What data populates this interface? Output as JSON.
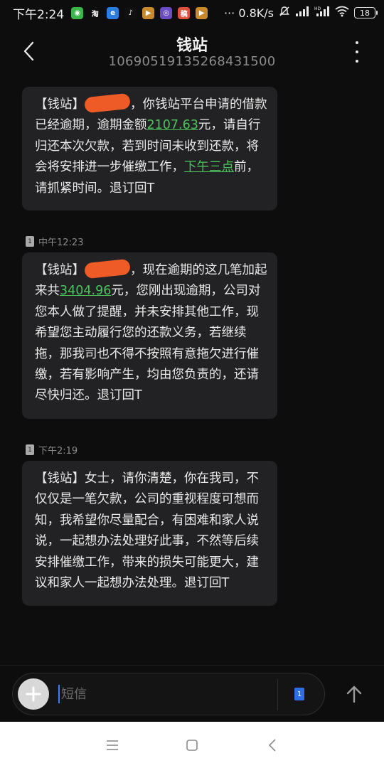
{
  "status_bar": {
    "time": "下午2:24",
    "speed": "··· 0.8K/s",
    "battery": "18",
    "app_icons": [
      {
        "name": "wechat-icon",
        "color": "#3bb54a",
        "glyph": "◉"
      },
      {
        "name": "taobao-icon",
        "color": "#0d0d0d",
        "glyph": "淘"
      },
      {
        "name": "browser-icon",
        "color": "#2a7de1",
        "glyph": "e"
      },
      {
        "name": "tiktok-icon",
        "color": "#111111",
        "glyph": "♪"
      },
      {
        "name": "video-app-icon",
        "color": "#c98a2d",
        "glyph": "▶"
      },
      {
        "name": "camera-app-icon",
        "color": "#6a4cc4",
        "glyph": "◎"
      },
      {
        "name": "schedule-app-icon",
        "color": "#e0513a",
        "glyph": "稿"
      },
      {
        "name": "video-app-2-icon",
        "color": "#c98a2d",
        "glyph": "▶"
      }
    ]
  },
  "header": {
    "title": "钱站",
    "number": "106905191352684315​00"
  },
  "messages": [
    {
      "time": "",
      "parts": [
        {
          "t": "【钱站】"
        },
        {
          "redact": true
        },
        {
          "t": "，你钱站平台申请的借款已经逾期，逾期金额"
        },
        {
          "link": "2107.63"
        },
        {
          "t": "元，请自行归还本次欠款，若到时间未收到还款，将会将安排进一步催缴工作，"
        },
        {
          "link": "下午三点"
        },
        {
          "t": "前，请抓紧时间。退订回T"
        }
      ]
    },
    {
      "time": "中午12:23",
      "parts": [
        {
          "t": "【钱站】"
        },
        {
          "redact": true
        },
        {
          "t": "，现在逾期的这几笔加起来共"
        },
        {
          "link": "3404.96"
        },
        {
          "t": "元，您刚出现逾期，公司对您本人做了提醒，并未安排其他工作，现希望您主动履行您的还款义务，若继续拖，那我司也不得不按照有意拖欠进行催缴，若有影响产生，均由您负责的，还请尽快归还。退订回T"
        }
      ]
    },
    {
      "time": "下午2:19",
      "parts": [
        {
          "t": "【钱站】女士，请你清楚，你在我司，不仅仅是一笔欠款，公司的重视程度可想而知，我希望你尽量配合，有困难和家人说说，一起想办法处理好此事，不然等后续安排催缴工作，带来的损失可能更大，建议和家人一起想办法处理。退订回T"
        }
      ]
    }
  ],
  "input": {
    "placeholder": "短信",
    "sim_label": "1"
  },
  "colors": {
    "link": "#4cc35a",
    "bubble": "#222224",
    "background": "#0d0d0d",
    "accent": "#2f6fe4"
  }
}
